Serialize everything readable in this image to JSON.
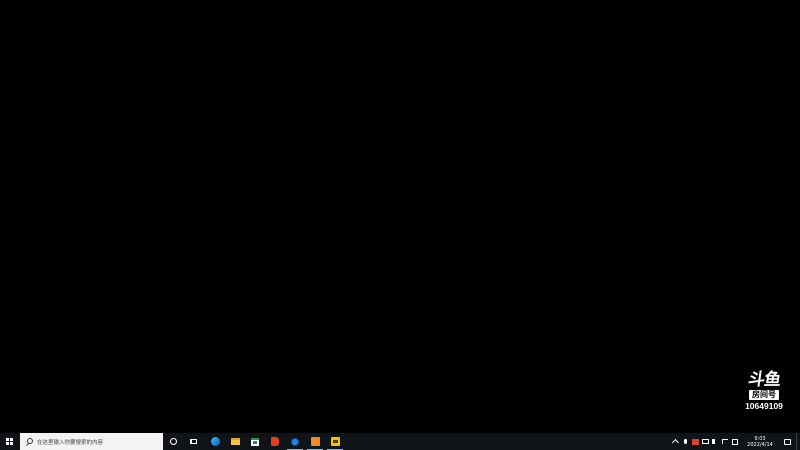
{
  "watermark": {
    "logo": "斗鱼",
    "badge": "房间号",
    "room_number": "10649109"
  },
  "taskbar": {
    "search_placeholder": "在这里输入你要搜索的内容",
    "clock": {
      "time": "9:03",
      "date": "2022/4/14"
    },
    "pinned_apps": [
      {
        "icon": "edge-icon",
        "active": false
      },
      {
        "icon": "file-explorer-icon",
        "active": false
      },
      {
        "icon": "microsoft-store-icon",
        "active": false
      },
      {
        "icon": "office-icon",
        "active": false
      },
      {
        "icon": "blue-gear-app-icon",
        "active": true
      },
      {
        "icon": "orange-app-icon",
        "active": true
      },
      {
        "icon": "yellow-app-icon",
        "active": true
      }
    ],
    "tray_icons": [
      "chevron-up-icon",
      "microphone-icon",
      "red-app-tray-icon",
      "network-icon",
      "volume-icon",
      "wifi-icon",
      "ime-icon"
    ],
    "colors": {
      "taskbar": "#101317",
      "search_box": "#f3f3f3",
      "desktop": "#000000"
    }
  }
}
